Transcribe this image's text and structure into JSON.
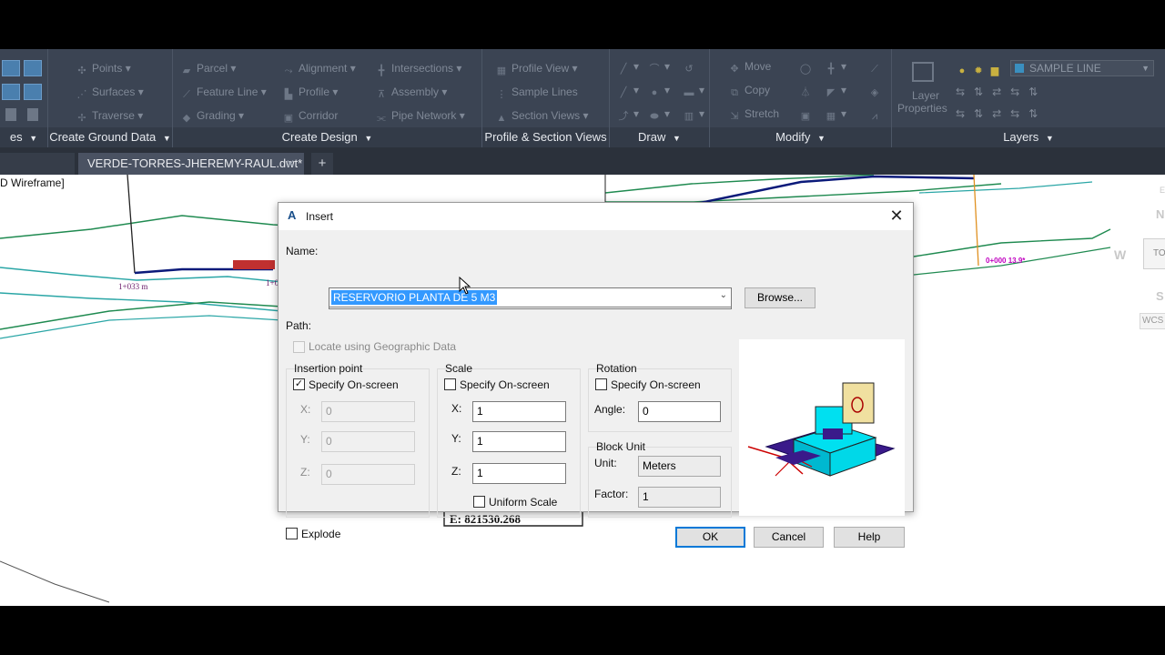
{
  "ribbon": {
    "groups": [
      {
        "title": "es",
        "items": []
      },
      {
        "title": "Create Ground Data",
        "items": [
          "Points",
          "Surfaces",
          "Traverse"
        ]
      },
      {
        "title": "Create Design",
        "items": [
          "Parcel",
          "Feature Line",
          "Grading",
          "Alignment",
          "Profile",
          "Corridor",
          "Intersections",
          "Assembly",
          "Pipe Network"
        ]
      },
      {
        "title": "Profile & Section Views",
        "items": [
          "Profile View",
          "Sample Lines",
          "Section Views"
        ]
      },
      {
        "title": "Draw",
        "items": []
      },
      {
        "title": "Modify",
        "items": [
          "Move",
          "Copy",
          "Stretch"
        ]
      },
      {
        "title": "Layers",
        "items": [
          "Layer",
          "Properties"
        ]
      }
    ],
    "layer_current": "SAMPLE LINE"
  },
  "tabs": {
    "active": "VERDE-TORRES-JHEREMY-RAUL.dwt*",
    "close": "✕",
    "add": "+"
  },
  "drawing": {
    "viewport_label": "D Wireframe]",
    "station_label": "1+033 m",
    "station_label2": "1+0",
    "coord_label": "E: 821530.268",
    "magenta_label": "0+000 13.9*",
    "viewcube": {
      "north": "N",
      "west": "W",
      "top": "TO",
      "south": "S",
      "wcs": "WCS",
      "edge": "E"
    }
  },
  "dialog": {
    "title": "Insert",
    "name_label": "Name:",
    "name_value": "RESERVORIO PLANTA DE 5 M3",
    "browse_label": "Browse...",
    "path_label": "Path:",
    "geo_label": "Locate using Geographic Data",
    "insertion": {
      "title": "Insertion point",
      "specify_label": "Specify On-screen",
      "specify_checked": true,
      "x_label": "X:",
      "x": "0",
      "y_label": "Y:",
      "y": "0",
      "z_label": "Z:",
      "z": "0"
    },
    "scale": {
      "title": "Scale",
      "specify_label": "Specify On-screen",
      "specify_checked": false,
      "x_label": "X:",
      "x": "1",
      "y_label": "Y:",
      "y": "1",
      "z_label": "Z:",
      "z": "1",
      "uniform_label": "Uniform Scale"
    },
    "rotation": {
      "title": "Rotation",
      "specify_label": "Specify On-screen",
      "specify_checked": false,
      "angle_label": "Angle:",
      "angle": "0"
    },
    "block_unit": {
      "title": "Block Unit",
      "unit_label": "Unit:",
      "unit": "Meters",
      "factor_label": "Factor:",
      "factor": "1"
    },
    "explode_label": "Explode",
    "ok_label": "OK",
    "cancel_label": "Cancel",
    "help_label": "Help"
  },
  "colors": {
    "ribbon_bg": "#3b4453",
    "tab_bg": "#2b313b",
    "accent": "#0078d7",
    "contour_green": "#1f8a50",
    "contour_teal": "#2aa6a6",
    "polyline_navy": "#0b1a7a",
    "magenta": "#c000c0"
  },
  "icons": [
    "autocad-a-icon",
    "close-icon",
    "dropdown-arrow-icon",
    "mouse-cursor-icon",
    "block-preview-icon",
    "layer-bulb-icon"
  ]
}
